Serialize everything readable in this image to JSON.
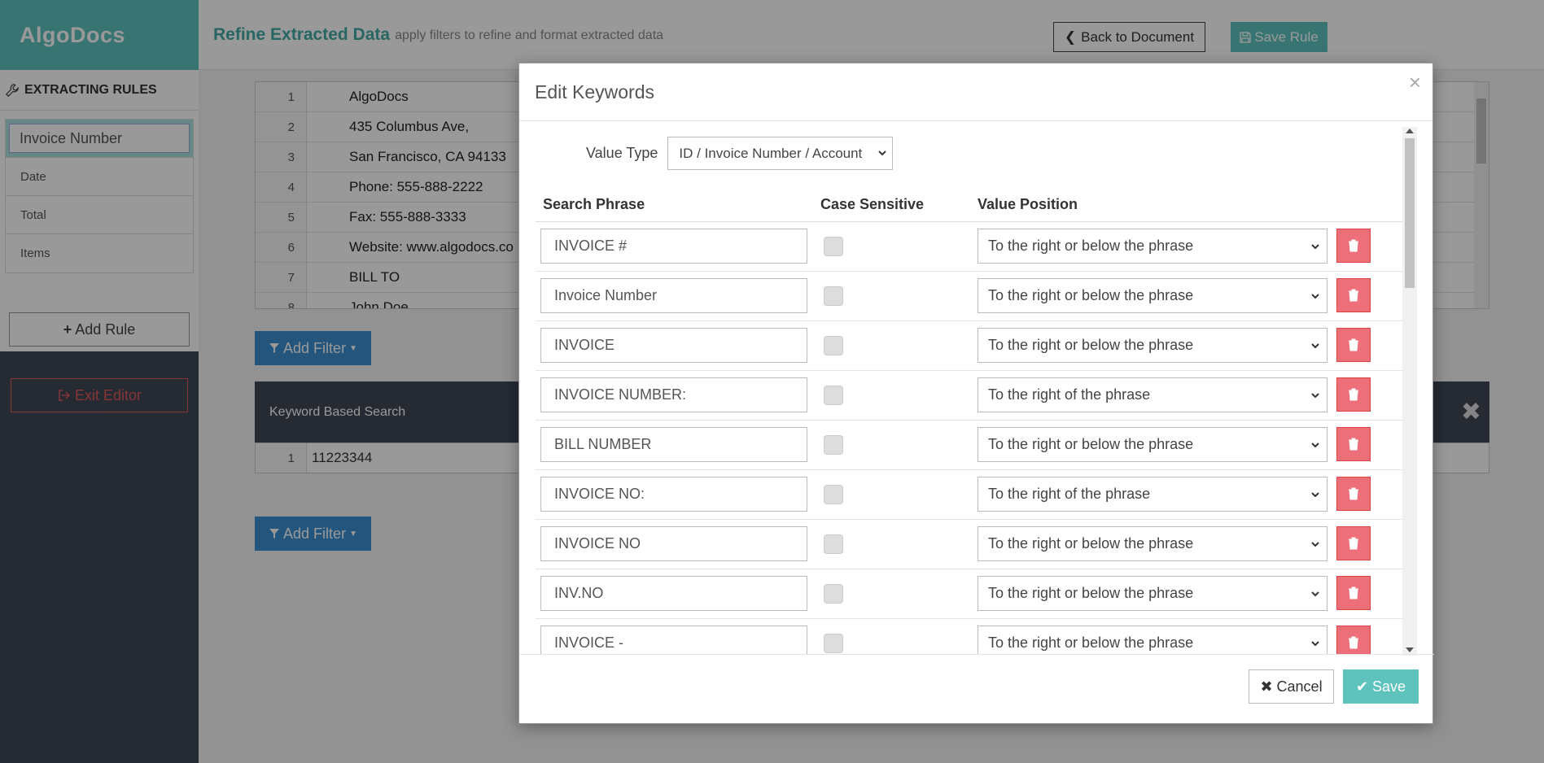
{
  "brand": "AlgoDocs",
  "header": {
    "title": "Refine Extracted Data",
    "subtitle": "apply filters to refine and format extracted data",
    "back_label": "Back to Document",
    "save_rule_label": "Save Rule"
  },
  "sidebar": {
    "title": "EXTRACTING RULES",
    "rules": [
      {
        "label": "Invoice Number"
      },
      {
        "label": "Date"
      },
      {
        "label": "Total"
      },
      {
        "label": "Items"
      }
    ],
    "add_rule_label": "Add Rule",
    "exit_label": "Exit Editor"
  },
  "document": {
    "lines": [
      {
        "num": "1",
        "text": "AlgoDocs"
      },
      {
        "num": "2",
        "text": "435 Columbus Ave,"
      },
      {
        "num": "3",
        "text": "San Francisco, CA 94133"
      },
      {
        "num": "4",
        "text": "Phone: 555-888-2222"
      },
      {
        "num": "5",
        "text": "Fax: 555-888-3333"
      },
      {
        "num": "6",
        "text": "Website: www.algodocs.co"
      },
      {
        "num": "7",
        "text": "BILL TO"
      },
      {
        "num": "8",
        "text": "John Doe"
      }
    ]
  },
  "filters": {
    "add_filter_label": "Add Filter",
    "keyword_search_label": "Keyword Based Search",
    "result_num": "1",
    "result_value": "11223344"
  },
  "modal": {
    "title": "Edit Keywords",
    "value_type_label": "Value Type",
    "value_type_selected": "ID / Invoice Number / Account",
    "columns": {
      "search_phrase": "Search Phrase",
      "case_sensitive": "Case Sensitive",
      "value_position": "Value Position"
    },
    "keywords": [
      {
        "phrase": "INVOICE #",
        "position": "To the right or below the phrase"
      },
      {
        "phrase": "Invoice Number",
        "position": "To the right or below the phrase"
      },
      {
        "phrase": "INVOICE",
        "position": "To the right or below the phrase"
      },
      {
        "phrase": "INVOICE NUMBER:",
        "position": "To the right of the phrase"
      },
      {
        "phrase": "BILL NUMBER",
        "position": "To the right or below the phrase"
      },
      {
        "phrase": "INVOICE NO:",
        "position": "To the right of the phrase"
      },
      {
        "phrase": "INVOICE NO",
        "position": "To the right or below the phrase"
      },
      {
        "phrase": "INV.NO",
        "position": "To the right or below the phrase"
      },
      {
        "phrase": "INVOICE -",
        "position": "To the right or below the phrase"
      }
    ],
    "cancel_label": "Cancel",
    "save_label": "Save"
  },
  "colors": {
    "accent": "#5ec2bd",
    "sidebar_bg": "#3e4756",
    "filter_blue": "#3d8fd1",
    "delete_red": "#ec6f7a",
    "exit_red": "#e15a5a"
  }
}
